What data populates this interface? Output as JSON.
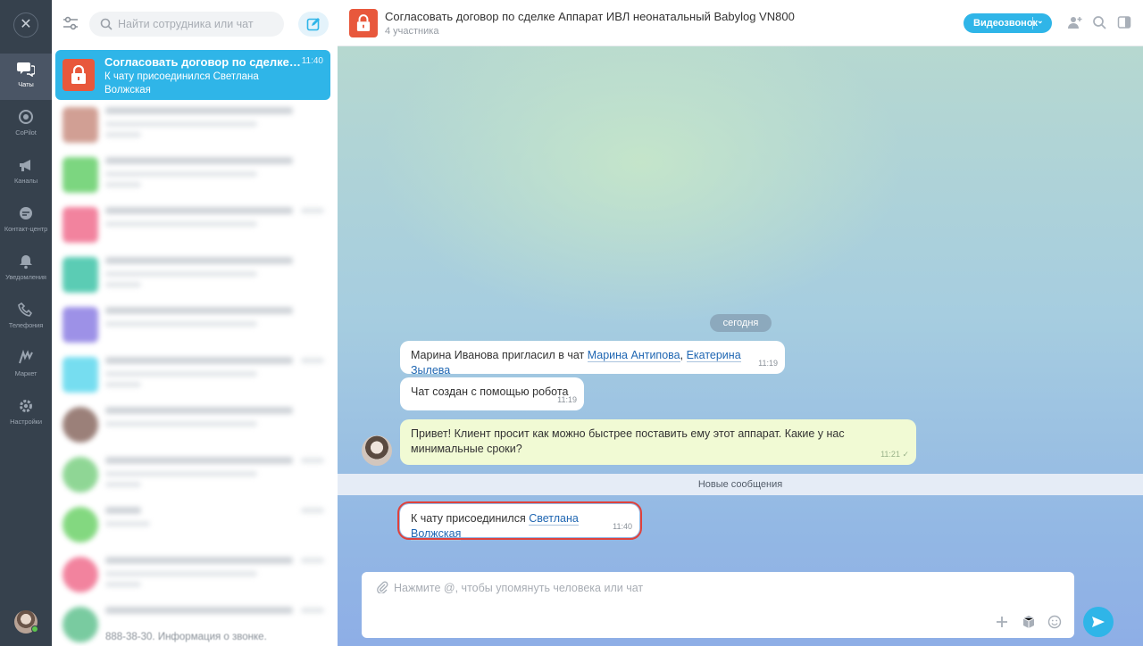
{
  "nav": {
    "close_glyph": "✕",
    "items": [
      {
        "label": "Чаты",
        "icon": "chat-icon"
      },
      {
        "label": "CoPilot",
        "icon": "copilot-icon"
      },
      {
        "label": "Каналы",
        "icon": "megaphone-icon"
      },
      {
        "label": "Контакт-центр",
        "icon": "contact-center-icon"
      },
      {
        "label": "Уведомления",
        "icon": "bell-icon"
      },
      {
        "label": "Телефония",
        "icon": "phone-icon"
      },
      {
        "label": "Маркет",
        "icon": "market-icon"
      },
      {
        "label": "Настройки",
        "icon": "gear-icon"
      }
    ]
  },
  "list": {
    "search_placeholder": "Найти сотрудника или чат",
    "active_chat": {
      "title": "Согласовать договор по сделке Апп...",
      "time": "11:40",
      "preview": "К чату присоединился Светлана Волжская"
    },
    "footer_snippet": "888-38-30. Информация о звонке."
  },
  "header": {
    "title": "Согласовать договор по сделке Аппарат ИВЛ неонатальный Babylog VN800",
    "subtitle": "4 участника",
    "video_button": "Видеозвонок",
    "video_caret": "⌄"
  },
  "chat": {
    "date_pill": "сегодня",
    "messages": [
      {
        "prefix": "Марина Иванова пригласил в чат ",
        "mention1": "Марина Антипова",
        "sep": ", ",
        "mention2": "Екатерина Зылева",
        "time": "11:19"
      },
      {
        "text": "Чат создан с помощью робота",
        "time": "11:19"
      },
      {
        "text": "Привет! Клиент просит как можно быстрее поставить ему этот аппарат. Какие у нас минимальные сроки?",
        "time": "11:21 ✓"
      }
    ],
    "new_messages_label": "Новые сообщения",
    "joined": {
      "prefix": "К чату присоединился ",
      "mention": "Светлана Волжская",
      "time": "11:40"
    }
  },
  "composer": {
    "placeholder": "Нажмите @, чтобы упомянуть человека или чат"
  },
  "colors": {
    "accent": "#2fb5e8",
    "chat_icon_bg": "#e8583c",
    "highlight_border": "#e0413b"
  }
}
